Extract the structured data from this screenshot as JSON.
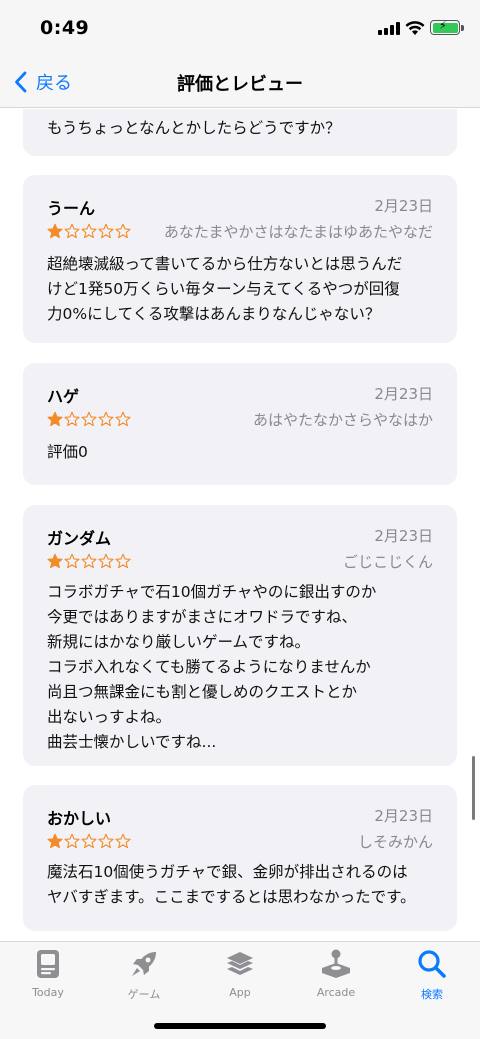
{
  "status_bar": {
    "time": "0:49"
  },
  "nav": {
    "back_label": "戻る",
    "title": "評価とレビュー"
  },
  "reviews": [
    {
      "title": "",
      "date": "",
      "rating": 0,
      "author": "",
      "body": "もうちょっとなんとかしたらどうですか？"
    },
    {
      "title": "うーん",
      "date": "2月23日",
      "rating": 1,
      "author": "あなたまやかさはなたまはゆあたやなだ",
      "body": "超絶壊滅級って書いてるから仕方ないとは思うんだ\nけど1発50万くらい毎ターン与えてくるやつが回復\n力0%にしてくる攻撃はあんまりなんじゃない？"
    },
    {
      "title": "ハゲ",
      "date": "2月23日",
      "rating": 1,
      "author": "あはやたなかさらやなはか",
      "body": "評価0"
    },
    {
      "title": "ガンダム",
      "date": "2月23日",
      "rating": 1,
      "author": "ごじこじくん",
      "body": "コラボガチャで石10個ガチャやのに銀出すのか\n今更ではありますがまさにオワドラですね、\n新規にはかなり厳しいゲームですね。\nコラボ入れなくても勝てるようになりませんか\n尚且つ無課金にも割と優しめのクエストとか\n出ないっすよね。\n曲芸士懐かしいですね..."
    },
    {
      "title": "おかしい",
      "date": "2月23日",
      "rating": 1,
      "author": "しそみかん",
      "body": "魔法石10個使うガチャで銀、金卵が排出されるのは\nヤバすぎます。ここまでするとは思わなかったです。"
    }
  ],
  "tabs": [
    {
      "label": "Today",
      "icon": "today-icon",
      "active": false
    },
    {
      "label": "ゲーム",
      "icon": "rocket-icon",
      "active": false
    },
    {
      "label": "App",
      "icon": "layers-icon",
      "active": false
    },
    {
      "label": "Arcade",
      "icon": "joystick-icon",
      "active": false
    },
    {
      "label": "検索",
      "icon": "search-icon",
      "active": true
    }
  ],
  "colors": {
    "accent": "#0a7aff",
    "star": "#f28c28",
    "card_bg": "#f2f2f6",
    "muted": "#8a8a8e"
  }
}
